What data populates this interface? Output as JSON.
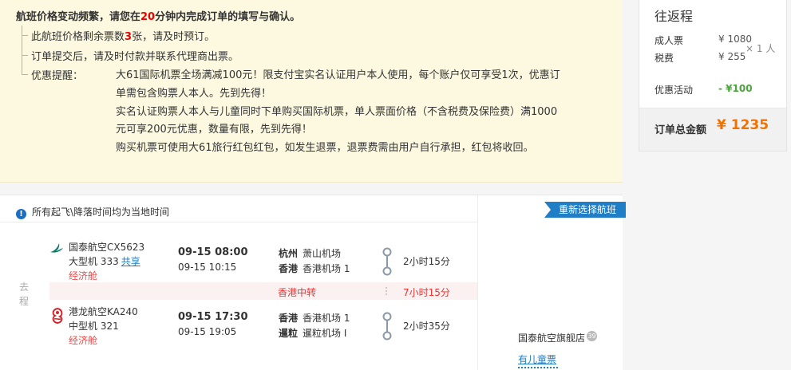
{
  "notice": {
    "title_prefix": "航班价格变动频繁，请您在",
    "title_minutes": "20",
    "title_suffix": "分钟内完成订单的填写与确认。",
    "item1_prefix": "此航班价格剩余票数",
    "item1_count": "3",
    "item1_suffix": "张，请及时预订。",
    "item2": "订单提交后，请及时付款并联系代理商出票。",
    "promo_label": "优惠提醒：",
    "promo_lines": [
      "大61国际机票全场满减100元！限支付宝实名认证用户本人使用，每个账户仅可享受1次，优惠订",
      "单需包含购票人本人。先到先得！",
      "实名认证购票人本人与儿童同时下单购买国际机票，单人票面价格（不含税费及保险费）满1000",
      "元可享200元优惠，数量有限，先到先得！",
      "购买机票可使用大61旅行红包红包，如发生退票，退票费需由用户自行承担，红包将收回。"
    ]
  },
  "price": {
    "title": "往返程",
    "adult_label": "成人票",
    "adult_value": "¥ 1080",
    "tax_label": "税费",
    "tax_value": "¥ 255",
    "times": "× 1 人",
    "promo_label": "优惠活动",
    "promo_value": "- ¥100",
    "total_label": "订单总金额",
    "total_value": "¥ 1235"
  },
  "flight": {
    "local_time_note": "所有起飞\\降落时间均为当地时间",
    "reselect_label": "重新选择航班",
    "leg_label": "去程",
    "segments": [
      {
        "airline": "国泰航空CX5623",
        "model": "大型机 333",
        "share": "共享",
        "cabin": "经济舱",
        "dep_time": "09-15 08:00",
        "arr_time": "09-15 10:15",
        "dep_city": "杭州",
        "dep_airport": "萧山机场",
        "arr_city": "香港",
        "arr_airport": "香港机场 1",
        "duration": "2小时15分"
      },
      {
        "airline": "港龙航空KA240",
        "model": "中型机 321",
        "share": "",
        "cabin": "经济舱",
        "dep_time": "09-15 17:30",
        "arr_time": "09-15 19:05",
        "dep_city": "香港",
        "dep_airport": "香港机场 1",
        "arr_city": "暹粒",
        "arr_airport": "暹粒机场 I",
        "duration": "2小时35分"
      }
    ],
    "transfer_label": "香港中转",
    "transfer_duration": "7小时15分",
    "store_name": "国泰航空旗舰店",
    "store_badge": "39",
    "child_ticket": "有儿童票"
  },
  "colors": {
    "accent_blue": "#1f7ec5",
    "price_orange": "#f27200",
    "discount_green": "#4aa63a",
    "alert_red": "#e00000",
    "notice_bg": "#fdf9e1"
  }
}
